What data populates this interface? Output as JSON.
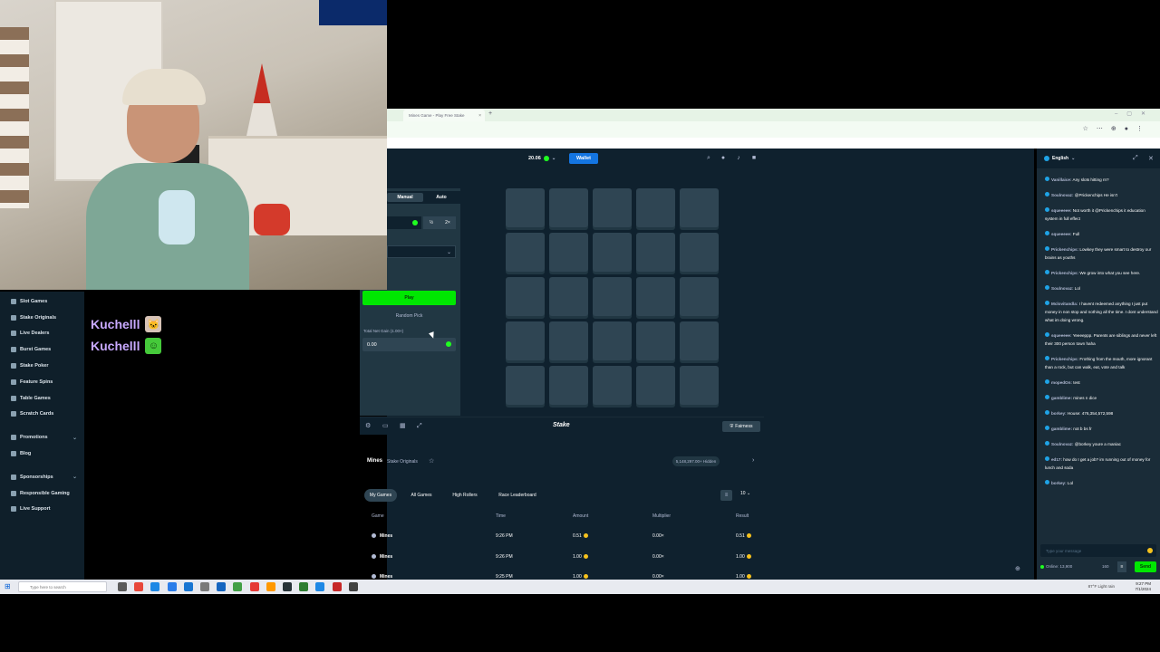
{
  "browser": {
    "tab_title": "Mines Game - Play Free Stake",
    "tab_close": "×",
    "new_tab": "+"
  },
  "stream_overlay": {
    "names": [
      {
        "name": "Kuchelll",
        "emote": "cat-emote"
      },
      {
        "name": "Kuchelll",
        "emote": "green-emote"
      }
    ]
  },
  "nav": {
    "items": [
      {
        "label": "Slot Games"
      },
      {
        "label": "Stake Originals"
      },
      {
        "label": "Live Dealers"
      },
      {
        "label": "Burst Games"
      },
      {
        "label": "Stake Poker"
      },
      {
        "label": "Feature Spins"
      },
      {
        "label": "Table Games"
      },
      {
        "label": "Scratch Cards"
      }
    ],
    "items2": [
      {
        "label": "Promotions",
        "chevron": "⌄"
      },
      {
        "label": "Blog"
      }
    ],
    "items3": [
      {
        "label": "Sponsorships",
        "chevron": "⌄"
      },
      {
        "label": "Responsible Gaming"
      },
      {
        "label": "Live Support"
      }
    ]
  },
  "topbar": {
    "balance": "20.06",
    "wallet_label": "Wallet"
  },
  "game": {
    "mode_manual": "Manual",
    "mode_auto": "Auto",
    "half": "½",
    "double": "2×",
    "play_label": "Play",
    "random_pick_label": "Random Pick",
    "profit_label": "Total Net Gain (1.00×)",
    "profit_value": "0.00",
    "grid_rows": 5,
    "grid_cols": 5,
    "logo": "Stake",
    "fairness_label": "Fairness"
  },
  "game_info": {
    "title": "Mines",
    "subtitle": "Stake Originals",
    "badge": "5,148,297.00+ Hidden"
  },
  "bets": {
    "tabs": [
      "My Games",
      "All Games",
      "High Rollers",
      "Race Leaderboard"
    ],
    "count": "10",
    "headers": {
      "game": "Game",
      "time": "Time",
      "amount": "Amount",
      "multiplier": "Multiplier",
      "result": "Result"
    },
    "rows": [
      {
        "game": "Mines",
        "time": "9:26 PM",
        "amount": "0.51",
        "multiplier": "0.00×",
        "result": "0.51"
      },
      {
        "game": "Mines",
        "time": "9:26 PM",
        "amount": "1.00",
        "multiplier": "0.00×",
        "result": "1.00"
      },
      {
        "game": "Mines",
        "time": "9:25 PM",
        "amount": "1.00",
        "multiplier": "0.00×",
        "result": "1.00"
      }
    ]
  },
  "chat": {
    "language": "English",
    "messages": [
      {
        "user": "Vanillaice:",
        "text": "Any slots hitting rn?"
      },
      {
        "user": "Soulnovaz:",
        "text": "@Prickenchips He isn't"
      },
      {
        "user": "squeeeee:",
        "text": "Not worth it @Prickenchips it education system in full effect"
      },
      {
        "user": "squeeeee:",
        "text": "Full"
      },
      {
        "user": "Prickenchips:",
        "text": "Lowkey they were smart to destroy our brains as youths"
      },
      {
        "user": "Prickenchips:",
        "text": "We grow into what you see here."
      },
      {
        "user": "Soulnovaz:",
        "text": "Lol"
      },
      {
        "user": "Mclovitandla:",
        "text": "I havent redeemed anything I just put money in non stop and nothing all the time. I dont understand what im doing wrong."
      },
      {
        "user": "squeeeee:",
        "text": "Yeeeeppp. Parents are siblings and never left their 300 person town haha"
      },
      {
        "user": "Prickenchips:",
        "text": "Frothing from the mouth, more ignorant than a rock, but can walk, eat, vote and talk"
      },
      {
        "user": "mopedOn:",
        "text": "test"
      },
      {
        "user": "gamblime:",
        "text": "mines n dice"
      },
      {
        "user": "borkey:",
        "text": "House: 476,354,572,598"
      },
      {
        "user": "gamblime:",
        "text": "not b bs fr"
      },
      {
        "user": "Soulnovaz:",
        "text": "@borkey youre a maniac"
      },
      {
        "user": "ed17:",
        "text": "how do I get a job? im running out of money for lunch and soda"
      },
      {
        "user": "borkey:",
        "text": "Lol"
      }
    ],
    "input_placeholder": "Type your message",
    "online": "Online: 13,900",
    "char_count": "160",
    "send_label": "Send"
  },
  "taskbar": {
    "search_placeholder": "Type here to search",
    "tray": "87°F Light rain",
    "time": "9:27 PM",
    "date": "7/1/2024"
  }
}
